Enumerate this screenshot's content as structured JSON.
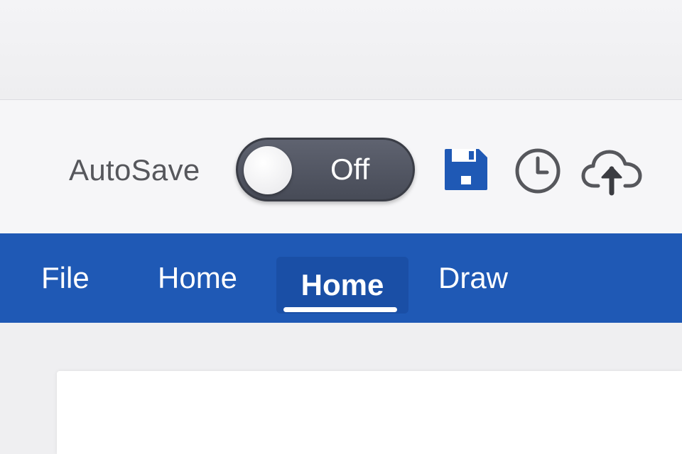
{
  "titlebar": {
    "autosave_label": "AutoSave",
    "autosave_state": "Off",
    "icons": [
      "save-icon",
      "history-icon",
      "cloud-upload-icon"
    ]
  },
  "ribbon": {
    "tabs": [
      {
        "label": "File",
        "active": false
      },
      {
        "label": "Home",
        "active": false
      },
      {
        "label": "Home",
        "active": true
      },
      {
        "label": "Draw",
        "active": false
      }
    ]
  },
  "colors": {
    "ribbon": "#1f59b5",
    "save_icon": "#1f59b5",
    "toggle_off": "#50545f",
    "icon_gray": "#56575c"
  }
}
